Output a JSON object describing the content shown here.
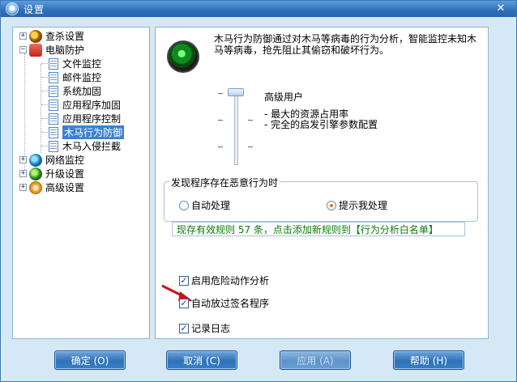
{
  "window": {
    "title": "设置",
    "close_glyph": "✕"
  },
  "tree": {
    "items": [
      {
        "label": "查杀设置",
        "expander": "+"
      },
      {
        "label": "电脑防护",
        "expander": "−"
      },
      {
        "label": "文件监控"
      },
      {
        "label": "邮件监控"
      },
      {
        "label": "系统加固"
      },
      {
        "label": "应用程序加固"
      },
      {
        "label": "应用程序控制"
      },
      {
        "label": "木马行为防御",
        "selected": true
      },
      {
        "label": "木马入侵拦截"
      },
      {
        "label": "网络监控",
        "expander": "+"
      },
      {
        "label": "升级设置",
        "expander": "+"
      },
      {
        "label": "高级设置",
        "expander": "+"
      }
    ]
  },
  "panel": {
    "description": "木马行为防御通过对木马等病毒的行为分析，智能监控未知木马等病毒，抢先阻止其偷窃和破坏行为。",
    "level": {
      "title": "高级用户",
      "desc_line1": "- 最大的资源占用率",
      "desc_line2": "- 完全的启发引擎参数配置",
      "tick_glyph": "-"
    },
    "group": {
      "label": "发现程序存在恶意行为时",
      "option_auto": "自动处理",
      "option_prompt": "提示我处理"
    },
    "rule_link": "现存有效规则 57 条，点击添加新规则到【行为分析白名单】",
    "checks": {
      "danger_analysis": "启用危险动作分析",
      "skip_signed": "自动放过签名程序",
      "log": "记录日志",
      "check_glyph": "✓"
    }
  },
  "buttons": {
    "ok": "确定 (O)",
    "cancel": "取消 (C)",
    "apply": "应用 (A)",
    "help": "帮助 (H)"
  },
  "colors": {
    "accent": "#2f72b8",
    "link_green": "#0b7a0b",
    "arrow_red": "#c8141a"
  }
}
